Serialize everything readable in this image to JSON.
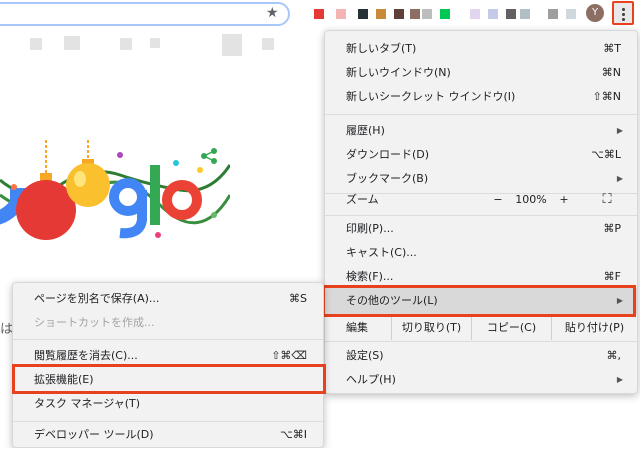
{
  "toolbar": {
    "avatar_letter": "Y",
    "star_icon": "★",
    "bookmark_colors": [
      "#e53935",
      "#f4b4b4",
      "#263238",
      "#c98a3a",
      "#5d4037",
      "#bdbdbd",
      "#9e9e9e",
      "#00c853",
      "#d1c4e9",
      "#c5cae9",
      "#616161",
      "#b0bec5"
    ]
  },
  "page": {
    "search_partial": "は"
  },
  "main_menu": {
    "items": [
      {
        "label": "新しいタブ(T)",
        "shortcut": "⌘T"
      },
      {
        "label": "新しいウインドウ(N)",
        "shortcut": "⌘N"
      },
      {
        "label": "新しいシークレット ウインドウ(I)",
        "shortcut": "⇧⌘N"
      },
      {
        "label": "履歴(H)",
        "arrow": "▶"
      },
      {
        "label": "ダウンロード(D)",
        "shortcut": "⌥⌘L"
      },
      {
        "label": "ブックマーク(B)",
        "arrow": "▶"
      },
      {
        "label": "印刷(P)...",
        "shortcut": "⌘P"
      },
      {
        "label": "キャスト(C)..."
      },
      {
        "label": "検索(F)...",
        "shortcut": "⌘F"
      },
      {
        "label": "その他のツール(L)",
        "arrow": "▶"
      },
      {
        "label": "設定(S)",
        "shortcut": "⌘,"
      },
      {
        "label": "ヘルプ(H)",
        "arrow": "▶"
      }
    ],
    "zoom": {
      "label": "ズーム",
      "minus": "−",
      "value": "100%",
      "plus": "+",
      "fullscreen": "⛶"
    },
    "edit": {
      "label": "編集",
      "cut": "切り取り(T)",
      "copy": "コピー(C)",
      "paste": "貼り付け(P)"
    }
  },
  "sub_menu": {
    "items": [
      {
        "label": "ページを別名で保存(A)...",
        "shortcut": "⌘S"
      },
      {
        "label": "ショートカットを作成...",
        "disabled": true
      },
      {
        "label": "閲覧履歴を消去(C)...",
        "shortcut": "⇧⌘⌫"
      },
      {
        "label": "拡張機能(E)"
      },
      {
        "label": "タスク マネージャ(T)"
      },
      {
        "label": "デベロッパー ツール(D)",
        "shortcut": "⌥⌘I"
      }
    ]
  }
}
